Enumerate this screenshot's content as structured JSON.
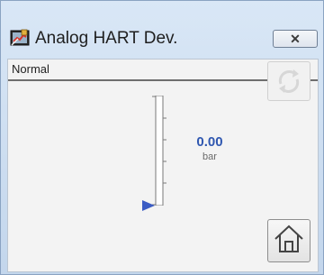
{
  "window": {
    "title": "Analog HART Dev.",
    "close_label": "✕"
  },
  "status": {
    "text": "Normal"
  },
  "gauge": {
    "value": "0.00",
    "unit": "bar",
    "level_fraction": 0,
    "value_color": "#2f57b0",
    "pointer_color": "#3b5cc4"
  },
  "icons": {
    "app": "faceplate-app-icon",
    "refresh": "refresh-icon",
    "home": "home-icon",
    "close": "close-icon"
  }
}
